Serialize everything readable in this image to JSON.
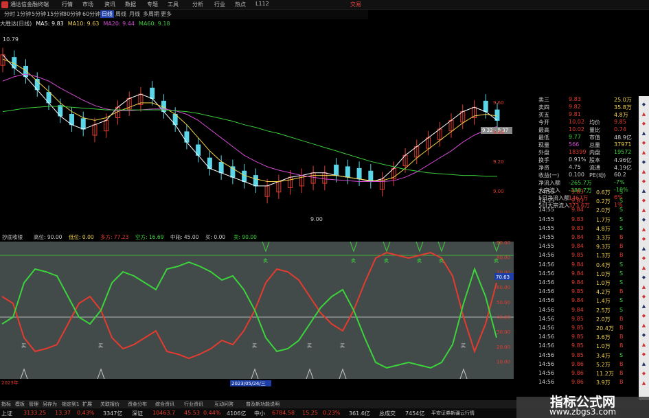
{
  "app": {
    "title": "通达信金融终端",
    "login": "交易",
    "version": "L112"
  },
  "menu": [
    "行情",
    "市场",
    "资讯",
    "数据",
    "专题",
    "工具",
    "分析",
    "行业",
    "热点"
  ],
  "timeframes": [
    {
      "label": "分时",
      "active": false
    },
    {
      "label": "1分钟",
      "active": false
    },
    {
      "label": "5分钟",
      "active": false
    },
    {
      "label": "15分钟",
      "active": false
    },
    {
      "label": "30分钟",
      "active": false
    },
    {
      "label": "60分钟",
      "active": false
    },
    {
      "label": "日线",
      "active": true
    },
    {
      "label": "周线",
      "active": false
    },
    {
      "label": "月线",
      "active": false
    },
    {
      "label": "多周期",
      "active": false
    },
    {
      "label": "更多",
      "active": false
    }
  ],
  "main_chart": {
    "stock": "大胜达(日线)",
    "ma": [
      {
        "label": "MA5: 9.83",
        "color": "#ffffff"
      },
      {
        "label": "MA10: 9.63",
        "color": "#f2d34b"
      },
      {
        "label": "MA20: 9.44",
        "color": "#d44bd4"
      },
      {
        "label": "MA60: 9.18",
        "color": "#3bcc3b"
      }
    ],
    "high_label": "10.79",
    "low_label": "9.00",
    "bubble": "9.32 - 9.37",
    "yticks": [
      "9.60",
      "9.40",
      "9.20",
      "9.00"
    ]
  },
  "indicator": {
    "name": "抄底收银",
    "params": [
      {
        "label": "高位: 90.00",
        "color": "#cccccc"
      },
      {
        "label": "低位: 0.00",
        "color": "#f2d34b"
      },
      {
        "label": "多方: 77.23",
        "color": "#e53b2e"
      },
      {
        "label": "空方: 16.69",
        "color": "#3bd43b"
      },
      {
        "label": "中轴: 45.00",
        "color": "#cccccc"
      },
      {
        "label": "买: 0.00",
        "color": "#cccccc"
      },
      {
        "label": "卖: 90.00",
        "color": "#3bd43b"
      }
    ],
    "yticks": [
      "90.00",
      "80.00",
      "70.00",
      "60.00",
      "50.00",
      "40.00",
      "30.00",
      "20.00",
      "10.00"
    ],
    "current_tag": "70.63",
    "buy_label": "买",
    "sell_label": "卖"
  },
  "date_axis": {
    "left": "2023年",
    "cursor": "2023/05/24/三"
  },
  "chart_data": [
    {
      "type": "candlestick",
      "title": "大胜达(日线)",
      "series": [
        {
          "name": "MA5",
          "values": [
            10.6,
            10.45,
            10.35,
            10.2,
            10.05,
            9.9,
            9.8,
            9.75,
            9.8,
            9.85,
            10.0,
            10.1,
            10.15,
            10.1,
            9.95,
            9.8,
            9.6,
            9.45,
            9.3,
            9.25,
            9.2,
            9.15,
            9.1,
            9.1,
            9.15,
            9.2,
            9.22,
            9.25,
            9.25,
            9.22,
            9.2,
            9.18,
            9.15,
            9.18,
            9.3,
            9.45,
            9.55,
            9.65,
            9.75,
            9.85,
            9.95,
            10.0,
            9.95,
            9.85
          ]
        },
        {
          "name": "MA10",
          "values": [
            10.55,
            10.5,
            10.42,
            10.3,
            10.18,
            10.05,
            9.95,
            9.88,
            9.85,
            9.88,
            9.95,
            10.0,
            10.05,
            10.05,
            10.0,
            9.92,
            9.8,
            9.65,
            9.5,
            9.38,
            9.3,
            9.22,
            9.18,
            9.15,
            9.15,
            9.17,
            9.2,
            9.22,
            9.22,
            9.22,
            9.2,
            9.18,
            9.16,
            9.16,
            9.2,
            9.3,
            9.42,
            9.52,
            9.62,
            9.72,
            9.82,
            9.9,
            9.92,
            9.9
          ]
        },
        {
          "name": "MA20",
          "values": [
            10.3,
            10.35,
            10.38,
            10.35,
            10.3,
            10.22,
            10.15,
            10.08,
            10.02,
            9.98,
            9.96,
            9.96,
            9.97,
            9.98,
            9.98,
            9.96,
            9.92,
            9.85,
            9.75,
            9.65,
            9.55,
            9.45,
            9.38,
            9.32,
            9.28,
            9.25,
            9.22,
            9.2,
            9.18,
            9.17,
            9.16,
            9.15,
            9.15,
            9.15,
            9.16,
            9.2,
            9.26,
            9.34,
            9.42,
            9.5,
            9.6,
            9.68,
            9.74,
            9.78
          ]
        },
        {
          "name": "MA60",
          "values": [
            9.95,
            9.97,
            9.99,
            10.0,
            10.01,
            10.01,
            10.0,
            9.99,
            9.98,
            9.97,
            9.97,
            9.97,
            9.97,
            9.97,
            9.97,
            9.96,
            9.95,
            9.93,
            9.9,
            9.87,
            9.84,
            9.8,
            9.77,
            9.73,
            9.7,
            9.66,
            9.62,
            9.58,
            9.54,
            9.5,
            9.46,
            9.42,
            9.38,
            9.35,
            9.32,
            9.29,
            9.27,
            9.25,
            9.24,
            9.23,
            9.22,
            9.22,
            9.21,
            9.21
          ]
        }
      ]
    },
    {
      "type": "line",
      "title": "抄底收银",
      "ylim": [
        0,
        100
      ],
      "series": [
        {
          "name": "多方",
          "values": [
            60,
            55,
            30,
            20,
            22,
            25,
            40,
            55,
            60,
            50,
            30,
            22,
            25,
            30,
            35,
            20,
            18,
            15,
            18,
            22,
            28,
            25,
            35,
            50,
            70,
            80,
            78,
            72,
            60,
            48,
            40,
            35,
            50,
            70,
            88,
            92,
            90,
            88,
            90,
            92,
            88,
            75,
            45,
            20,
            40,
            70
          ]
        },
        {
          "name": "空方",
          "values": [
            40,
            45,
            70,
            80,
            78,
            75,
            60,
            45,
            40,
            50,
            70,
            78,
            75,
            70,
            65,
            80,
            82,
            85,
            82,
            78,
            72,
            75,
            65,
            50,
            30,
            20,
            22,
            28,
            40,
            52,
            60,
            65,
            50,
            30,
            12,
            8,
            10,
            12,
            10,
            8,
            12,
            25,
            55,
            80,
            60,
            30
          ]
        }
      ]
    }
  ],
  "quote": {
    "rows": [
      {
        "l": "卖三",
        "v": "9.83",
        "c": "#e53b2e",
        "v2": "25.0万",
        "c2": "#f2d34b"
      },
      {
        "l": "卖四",
        "v": "9.82",
        "c": "#e53b2e",
        "v2": "35.8万",
        "c2": "#f2d34b"
      },
      {
        "l": "买五",
        "v": "9.81",
        "c": "#e53b2e",
        "v2": "4.8万",
        "c2": "#f2d34b"
      },
      {
        "l": "今开",
        "v": "10.02",
        "c": "#e53b2e",
        "l2": "均价",
        "v2": "9.85",
        "c2": "#e53b2e"
      },
      {
        "l": "最高",
        "v": "10.02",
        "c": "#e53b2e",
        "l2": "量比",
        "v2": "0.74",
        "c2": "#e53b2e"
      },
      {
        "l": "最低",
        "v": "9.77",
        "c": "#3bd43b",
        "l2": "市值",
        "v2": "48.9亿",
        "c2": "#cccccc"
      },
      {
        "l": "现量",
        "v": "566",
        "c": "#d44bd4",
        "l2": "总量",
        "v2": "37971",
        "c2": "#f2d34b"
      },
      {
        "l": "外盘",
        "v": "18399",
        "c": "#e53b2e",
        "l2": "内盘",
        "v2": "19572",
        "c2": "#3bd43b"
      },
      {
        "l": "换手",
        "v": "0.91%",
        "c": "#cccccc",
        "l2": "股本",
        "v2": "4.96亿",
        "c2": "#cccccc"
      },
      {
        "l": "净资",
        "v": "4.75",
        "c": "#cccccc",
        "l2": "流通",
        "v2": "4.19亿",
        "c2": "#cccccc"
      },
      {
        "l": "收益(一)",
        "v": "0.100",
        "c": "#cccccc",
        "l2": "PE(动)",
        "v2": "60.2",
        "c2": "#cccccc"
      },
      {
        "l": "净流入额",
        "v": "-265.7万",
        "c": "#3bd43b",
        "v2": "-7%",
        "c2": "#3bd43b"
      },
      {
        "l": "大宗流入",
        "v": "-388.7万",
        "c": "#3bd43b",
        "v2": "-10%",
        "c2": "#3bd43b"
      },
      {
        "l": "5日净流入额",
        "v": "1467万",
        "c": "#e53b2e",
        "v2": "6%",
        "c2": "#e53b2e"
      },
      {
        "l": "5日大宗流入",
        "v": "373.6万",
        "c": "#e53b2e",
        "v2": "1%",
        "c2": "#e53b2e"
      }
    ],
    "ticks": [
      {
        "t": "14:55",
        "p": "9.83",
        "v": "0.6万",
        "s": "S"
      },
      {
        "t": "14:55",
        "p": "9.83",
        "v": "0.2万",
        "s": "S"
      },
      {
        "t": "14:55",
        "p": "9.84",
        "v": "2.0万",
        "s": "S"
      },
      {
        "t": "14:55",
        "p": "9.83",
        "v": "1.7万",
        "s": "S"
      },
      {
        "t": "14:55",
        "p": "9.83",
        "v": "4.8万",
        "s": "S"
      },
      {
        "t": "14:55",
        "p": "9.84",
        "v": "3.3万",
        "s": "B"
      },
      {
        "t": "14:55",
        "p": "9.84",
        "v": "9.3万",
        "s": "B"
      },
      {
        "t": "14:56",
        "p": "9.85",
        "v": "1.3万",
        "s": "B"
      },
      {
        "t": "14:56",
        "p": "9.84",
        "v": "0.4万",
        "s": "S"
      },
      {
        "t": "14:56",
        "p": "9.84",
        "v": "1.0万",
        "s": "S"
      },
      {
        "t": "14:56",
        "p": "9.84",
        "v": "1.0万",
        "s": "S"
      },
      {
        "t": "14:56",
        "p": "9.85",
        "v": "4.2万",
        "s": "B"
      },
      {
        "t": "14:56",
        "p": "9.84",
        "v": "1.4万",
        "s": "S"
      },
      {
        "t": "14:56",
        "p": "9.84",
        "v": "2.5万",
        "s": "S"
      },
      {
        "t": "14:56",
        "p": "9.85",
        "v": "2.0万",
        "s": "B"
      },
      {
        "t": "14:56",
        "p": "9.85",
        "v": "20.4万",
        "s": "B"
      },
      {
        "t": "14:56",
        "p": "9.85",
        "v": "3.6万",
        "s": "B"
      },
      {
        "t": "14:56",
        "p": "9.85",
        "v": "1.0万",
        "s": "B"
      },
      {
        "t": "14:56",
        "p": "9.85",
        "v": "3.4万",
        "s": "S"
      },
      {
        "t": "14:56",
        "p": "9.86",
        "v": "5.2万",
        "s": "B"
      },
      {
        "t": "14:56",
        "p": "9.86",
        "v": "11.2万",
        "s": "B"
      },
      {
        "t": "14:56",
        "p": "9.86",
        "v": "3.9万",
        "s": "B"
      }
    ]
  },
  "bottom_tabs": [
    "指标",
    "模板",
    "管理",
    "另存为",
    "锁定到1",
    "扩展",
    "关联报价",
    "资金分布",
    "综合资讯",
    "行业资讯",
    "互动问答",
    "普及新功能说明"
  ],
  "status": {
    "sh_label": "上证",
    "sh_val": "3133.25",
    "sh_chg": "13.37",
    "sh_pct": "0.43%",
    "sh_amt": "3347亿",
    "sz_label": "深证",
    "sz_val": "10463.7",
    "sz_chg": "45.53",
    "sz_pct": "0.44%",
    "sz_amt": "4106亿",
    "zx_label": "中小",
    "zx_val": "6784.58",
    "zx_chg": "15.25",
    "zx_pct": "0.23%",
    "zx_amt": "361.6亿",
    "tot_label": "总成交",
    "tot_val": "7454亿",
    "broker": "平安证券新疆云行情"
  },
  "watermark": {
    "title": "指标公式网",
    "url": "www.zbgs3.com"
  }
}
